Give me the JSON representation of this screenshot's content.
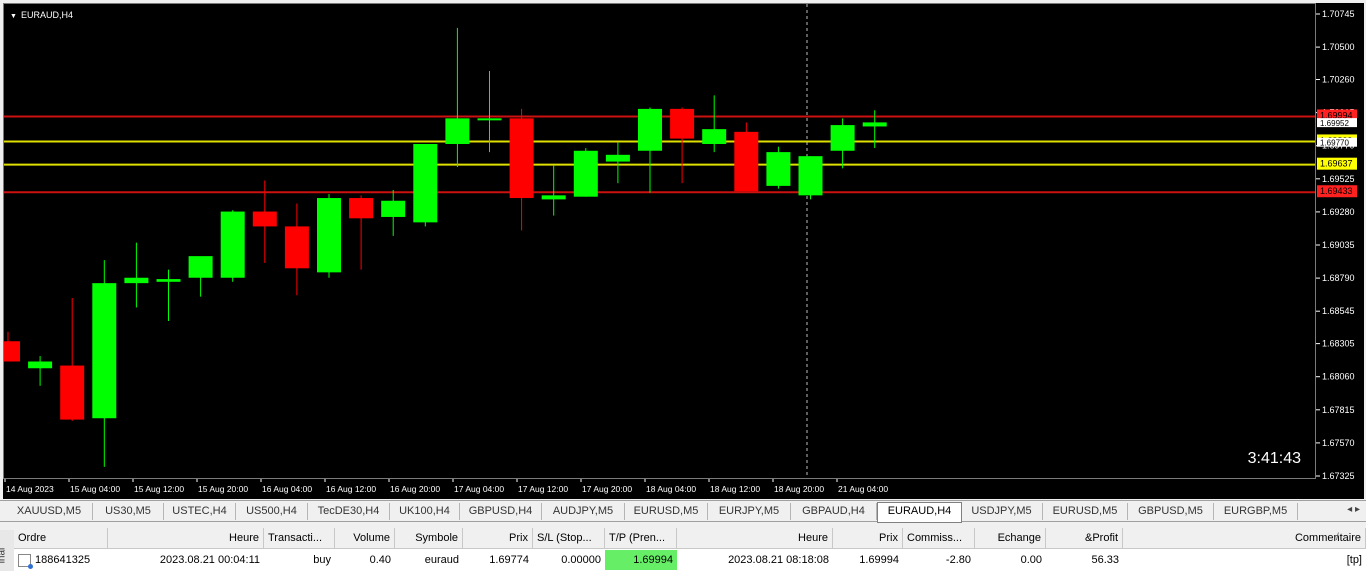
{
  "chart": {
    "symbol_title": "EURAUD,H4",
    "timer": "3:41:43",
    "bg_color": "#000000",
    "bull_color": "#00ff00",
    "bear_color": "#ff0000",
    "price_axis": [
      "1.70745",
      "1.70500",
      "1.70260",
      "1.70015",
      "1.69770",
      "1.69525",
      "1.69280",
      "1.69035",
      "1.68790",
      "1.68545",
      "1.68305",
      "1.68060",
      "1.67815",
      "1.67570",
      "1.67325"
    ],
    "time_axis": [
      "14 Aug 2023",
      "15 Aug 04:00",
      "15 Aug 12:00",
      "15 Aug 20:00",
      "16 Aug 04:00",
      "16 Aug 12:00",
      "16 Aug 20:00",
      "17 Aug 04:00",
      "17 Aug 12:00",
      "17 Aug 20:00",
      "18 Aug 04:00",
      "18 Aug 12:00",
      "18 Aug 20:00",
      "21 Aug 04:00"
    ],
    "levels": [
      {
        "label": "1.69994",
        "price": 1.69994,
        "color": "#cc1111",
        "tag_bg": "#ff2020",
        "tag_fg": "#000000"
      },
      {
        "label": "1.69809",
        "price": 1.69809,
        "color": "#e0e000",
        "tag_bg": "#ffff00",
        "tag_fg": "#000000"
      },
      {
        "label": "1.69637",
        "price": 1.69637,
        "color": "#e0e000",
        "tag_bg": "#ffff00",
        "tag_fg": "#000000"
      },
      {
        "label": "1.69433",
        "price": 1.69433,
        "color": "#cc1111",
        "tag_bg": "#ff2020",
        "tag_fg": "#000000"
      }
    ],
    "current_price_label": "1.69952",
    "current_price_label_2": "1.69770",
    "candles": [
      {
        "o": 1.6833,
        "h": 1.684,
        "l": 1.6818,
        "c": 1.6818
      },
      {
        "o": 1.6813,
        "h": 1.6822,
        "l": 1.68,
        "c": 1.6818
      },
      {
        "o": 1.6815,
        "h": 1.6865,
        "l": 1.6774,
        "c": 1.6775
      },
      {
        "o": 1.6776,
        "h": 1.6893,
        "l": 1.674,
        "c": 1.6876
      },
      {
        "o": 1.6876,
        "h": 1.6906,
        "l": 1.6858,
        "c": 1.688
      },
      {
        "o": 1.6877,
        "h": 1.6886,
        "l": 1.6848,
        "c": 1.6879
      },
      {
        "o": 1.688,
        "h": 1.6895,
        "l": 1.6866,
        "c": 1.6896
      },
      {
        "o": 1.688,
        "h": 1.693,
        "l": 1.6877,
        "c": 1.6929
      },
      {
        "o": 1.6929,
        "h": 1.6952,
        "l": 1.6891,
        "c": 1.6918
      },
      {
        "o": 1.6918,
        "h": 1.6935,
        "l": 1.6867,
        "c": 1.6887
      },
      {
        "o": 1.6884,
        "h": 1.6942,
        "l": 1.688,
        "c": 1.6939
      },
      {
        "o": 1.6939,
        "h": 1.6941,
        "l": 1.6886,
        "c": 1.6924
      },
      {
        "o": 1.6925,
        "h": 1.6945,
        "l": 1.6911,
        "c": 1.6937
      },
      {
        "o": 1.6921,
        "h": 1.6977,
        "l": 1.6918,
        "c": 1.6979
      },
      {
        "o": 1.6979,
        "h": 1.7065,
        "l": 1.6962,
        "c": 1.6998
      },
      {
        "o": 1.6998,
        "h": 1.7033,
        "l": 1.6973,
        "c": 1.6998
      },
      {
        "o": 1.6998,
        "h": 1.7005,
        "l": 1.6915,
        "c": 1.6939
      },
      {
        "o": 1.6938,
        "h": 1.6963,
        "l": 1.6926,
        "c": 1.6941
      },
      {
        "o": 1.694,
        "h": 1.6976,
        "l": 1.694,
        "c": 1.6974
      },
      {
        "o": 1.6966,
        "h": 1.698,
        "l": 1.695,
        "c": 1.6971
      },
      {
        "o": 1.6974,
        "h": 1.7006,
        "l": 1.6943,
        "c": 1.7005
      },
      {
        "o": 1.7005,
        "h": 1.7006,
        "l": 1.695,
        "c": 1.6983
      },
      {
        "o": 1.6979,
        "h": 1.7015,
        "l": 1.6973,
        "c": 1.699
      },
      {
        "o": 1.6988,
        "h": 1.6995,
        "l": 1.6947,
        "c": 1.6944
      },
      {
        "o": 1.6948,
        "h": 1.6977,
        "l": 1.6946,
        "c": 1.6973
      },
      {
        "o": 1.6941,
        "h": 1.697,
        "l": 1.6938,
        "c": 1.697
      },
      {
        "o": 1.6974,
        "h": 1.6998,
        "l": 1.6961,
        "c": 1.6993
      },
      {
        "o": 1.6992,
        "h": 1.7004,
        "l": 1.6976,
        "c": 1.6995
      }
    ]
  },
  "tabs": [
    {
      "label": "XAUUSD,M5",
      "active": false
    },
    {
      "label": "US30,M5",
      "active": false
    },
    {
      "label": "USTEC,H4",
      "active": false
    },
    {
      "label": "US500,H4",
      "active": false
    },
    {
      "label": "TecDE30,H4",
      "active": false
    },
    {
      "label": "UK100,H4",
      "active": false
    },
    {
      "label": "GBPUSD,H4",
      "active": false
    },
    {
      "label": "AUDJPY,M5",
      "active": false
    },
    {
      "label": "EURUSD,M5",
      "active": false
    },
    {
      "label": "EURJPY,M5",
      "active": false
    },
    {
      "label": "GBPAUD,H4",
      "active": false
    },
    {
      "label": "EURAUD,H4",
      "active": true
    },
    {
      "label": "USDJPY,M5",
      "active": false
    },
    {
      "label": "EURUSD,M5",
      "active": false
    },
    {
      "label": "GBPUSD,M5",
      "active": false
    },
    {
      "label": "EURGBP,M5",
      "active": false
    }
  ],
  "tab_scroll_arrows": "◂ ▸",
  "terminal_label": "inal",
  "grid": {
    "headers": [
      "Ordre",
      "Heure",
      "Transacti...",
      "Volume",
      "Symbole",
      "Prix",
      "S/L (Stop...",
      "T/P (Pren...",
      "Heure",
      "Prix",
      "Commiss...",
      "Echange",
      "&Profit",
      "Commentaire"
    ],
    "sort_indicator": "/",
    "row": [
      "188641325",
      "2023.08.21 00:04:11",
      "buy",
      "0.40",
      "euraud",
      "1.69774",
      "0.00000",
      "1.69994",
      "2023.08.21 08:18:08",
      "1.69994",
      "-2.80",
      "0.00",
      "56.33",
      "[tp]"
    ]
  }
}
